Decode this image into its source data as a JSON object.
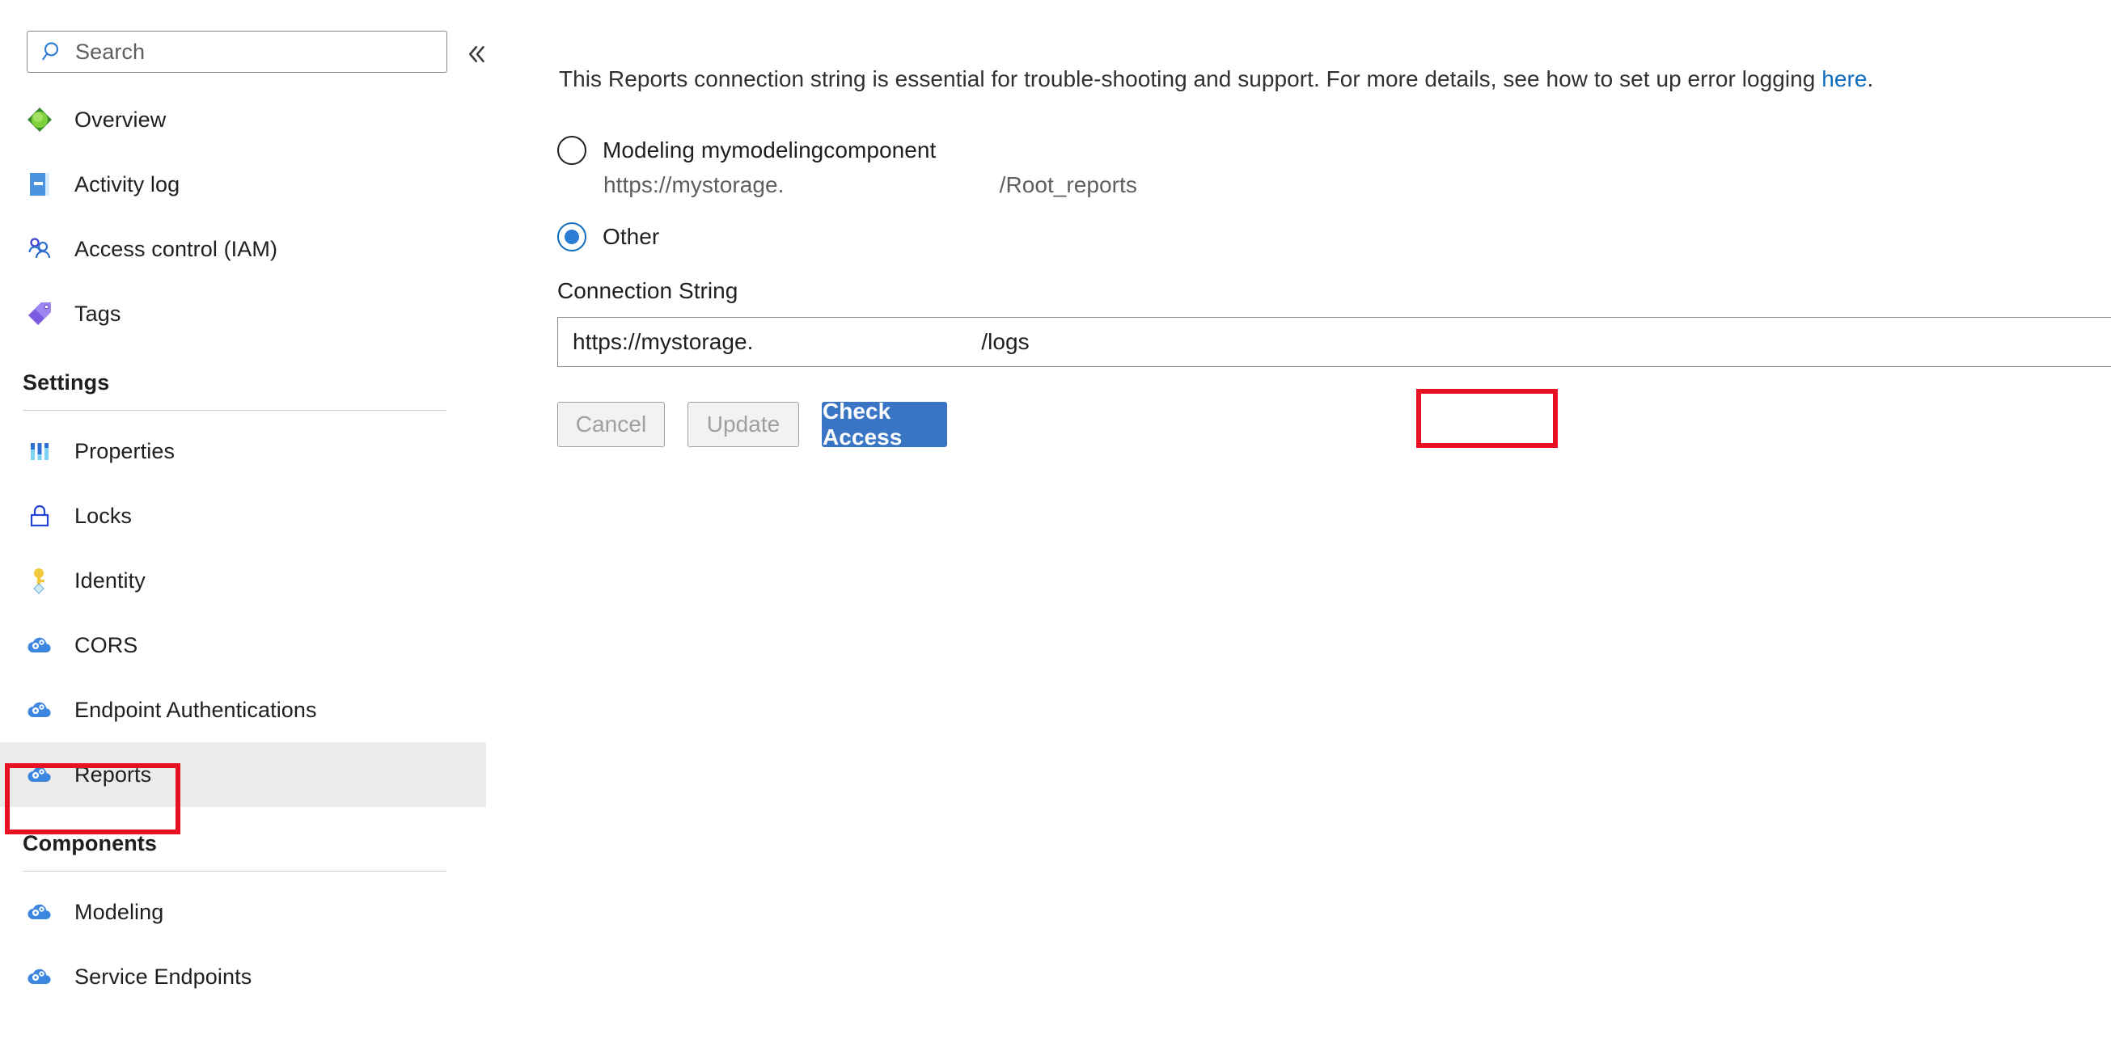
{
  "sidebar": {
    "search": {
      "placeholder": "Search",
      "icon": "search-icon"
    },
    "collapse": {
      "icon": "chevron-double-left-icon",
      "glyph": "«"
    },
    "items": [
      {
        "label": "Overview",
        "icon": "overview-icon",
        "selected": false
      },
      {
        "label": "Activity log",
        "icon": "activity-log-icon",
        "selected": false
      },
      {
        "label": "Access control (IAM)",
        "icon": "access-control-icon",
        "selected": false
      },
      {
        "label": "Tags",
        "icon": "tags-icon",
        "selected": false
      }
    ],
    "groups": [
      {
        "title": "Settings",
        "items": [
          {
            "label": "Properties",
            "icon": "properties-icon",
            "selected": false
          },
          {
            "label": "Locks",
            "icon": "lock-icon",
            "selected": false
          },
          {
            "label": "Identity",
            "icon": "key-icon",
            "selected": false
          },
          {
            "label": "CORS",
            "icon": "cloud-gear-icon",
            "selected": false
          },
          {
            "label": "Endpoint Authentications",
            "icon": "cloud-gear-icon",
            "selected": false
          },
          {
            "label": "Reports",
            "icon": "cloud-gear-icon",
            "selected": true
          }
        ]
      },
      {
        "title": "Components",
        "items": [
          {
            "label": "Modeling",
            "icon": "cloud-gear-icon",
            "selected": false
          },
          {
            "label": "Service Endpoints",
            "icon": "cloud-gear-icon",
            "selected": false
          }
        ]
      }
    ],
    "scrollbar": {
      "up_arrow_icon": "scroll-up-arrow-icon"
    }
  },
  "main": {
    "intro": {
      "text_before": "This Reports connection string is essential for trouble-shooting and support. For more details, see how to set up error logging ",
      "link_text": "here",
      "text_after": "."
    },
    "radios": [
      {
        "label": "Modeling mymodelingcomponent",
        "checked": false,
        "sub_text": "https://mystorage.                                  /Root_reports"
      },
      {
        "label": "Other",
        "checked": true,
        "sub_text": ""
      }
    ],
    "connection_string": {
      "label": "Connection String",
      "value": "https://mystorage.                                    /logs",
      "placeholder": "Connection String"
    },
    "buttons": {
      "cancel": {
        "label": "Cancel",
        "disabled": true
      },
      "update": {
        "label": "Update",
        "disabled": true
      },
      "check_access": {
        "label": "Check Access",
        "disabled": false
      }
    }
  },
  "annotations": {
    "highlight_color": "#e81123",
    "boxes": [
      {
        "name": "reports-nav-highlight"
      },
      {
        "name": "check-access-highlight"
      }
    ]
  },
  "colors": {
    "primary_button": "#3a74c4",
    "link": "#0f6cbd",
    "selected_row": "#edebe9",
    "highlight": "#e81123"
  }
}
